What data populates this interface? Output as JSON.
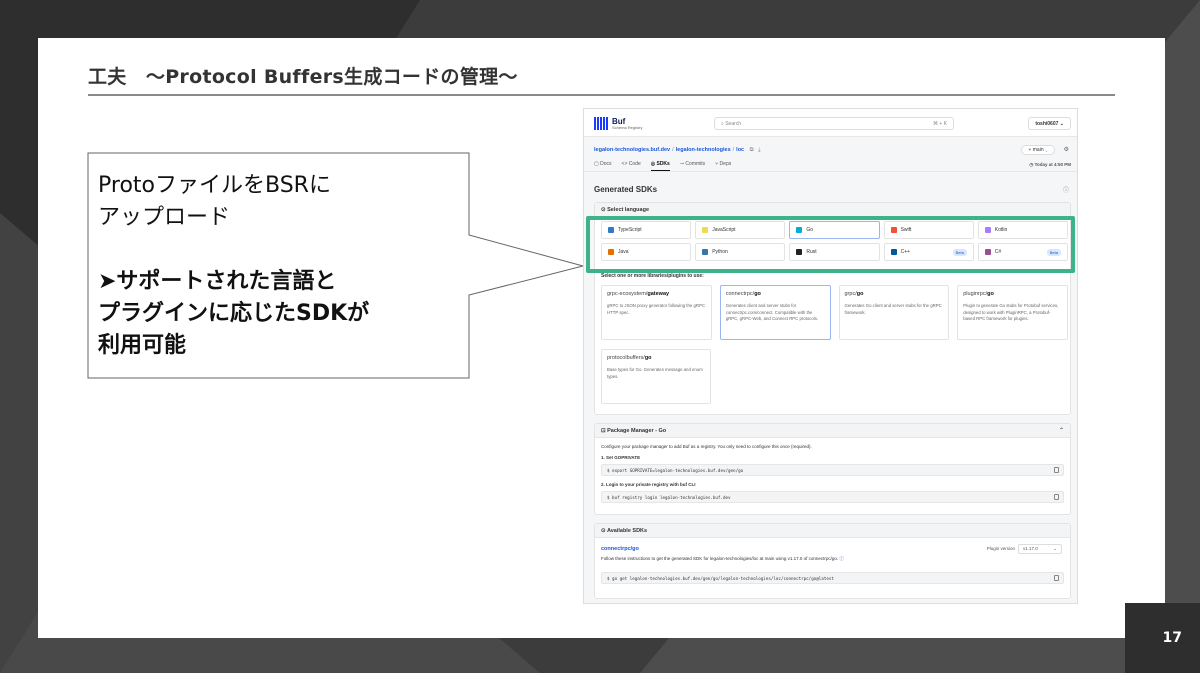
{
  "slide": {
    "title": "工夫　～Protocol Buffers生成コードの管理～",
    "page_number": "17"
  },
  "callout": {
    "line1": "ProtoファイルをBSRに",
    "line2": "アップロード",
    "line3": "➤サポートされた言語と",
    "line4": "プラグインに応じたSDKが",
    "line5": "利用可能"
  },
  "app": {
    "logo_title": "Buf",
    "logo_sub": "Schema Registry",
    "search_placeholder": "Search",
    "search_shortcut": "⌘ + K",
    "user": "toshi0607",
    "breadcrumb": [
      "legalon-technologies.buf.dev",
      "legalon-technologies",
      "loc"
    ],
    "branch": "main",
    "tabs": [
      "Docs",
      "Code",
      "SDKs",
      "Commits",
      "Deps"
    ],
    "updated": "Today at 4:50 PM",
    "section_title": "Generated SDKs",
    "select_language": "Select language",
    "languages": [
      {
        "name": "TypeScript",
        "color": "#3178c6"
      },
      {
        "name": "JavaScript",
        "color": "#f0db4f"
      },
      {
        "name": "Go",
        "color": "#00add8"
      },
      {
        "name": "Swift",
        "color": "#f05138"
      },
      {
        "name": "Kotlin",
        "color": "#a97bff"
      },
      {
        "name": "Java",
        "color": "#e76f00"
      },
      {
        "name": "Python",
        "color": "#3776ab"
      },
      {
        "name": "Rust",
        "color": "#222222"
      },
      {
        "name": "C++",
        "color": "#00599c",
        "badge": "Beta"
      },
      {
        "name": "C#",
        "color": "#9b4f96",
        "badge": "Beta"
      }
    ],
    "plugins_label": "Select one or more libraries/plugins to use:",
    "plugins": [
      {
        "prefix": "grpc-ecosystem/",
        "name": "gateway",
        "desc": "gRPC to JSON proxy generator following the gRPC HTTP spec."
      },
      {
        "prefix": "connectrpc/",
        "name": "go",
        "desc": "Generates client and server stubs for connectrpc.com/connect. Compatible with the gRPC, gRPC-Web, and Connect RPC protocols."
      },
      {
        "prefix": "grpc/",
        "name": "go",
        "desc": "Generates Go client and server stubs for the gRPC framework."
      },
      {
        "prefix": "pluginrpc/",
        "name": "go",
        "desc": "Plugin to generate Go stubs for Protobuf services, designed to work with PluginRPC, a Protobuf-based RPC framework for plugins."
      }
    ],
    "plugin_extra": {
      "prefix": "protocolbuffers/",
      "name": "go",
      "desc": "Base types for Go. Generates message and enum types."
    },
    "package_manager": {
      "title": "Package Manager - Go",
      "intro": "Configure your package manager to add Buf as a registry. You only need to configure this once (required).",
      "step1": "1. Set GOPRIVATE",
      "cmd1": "$ export GOPRIVATE=legalon-technologies.buf.dev/gen/go",
      "step2": "2. Login to your private registry with buf CLI",
      "cmd2": "$ buf registry login legalon-technologies.buf.dev"
    },
    "available": {
      "title": "Available SDKs",
      "sdk": "connectrpc/go",
      "plugin_version_label": "Plugin version",
      "plugin_version": "v1.17.0",
      "instructions": "Follow these instructions to get the generated SDK for legalon-technologies/loc at main using v1.17.0 of connectrpc/go.",
      "cmd": "$ go get legalon-technologies.buf.dev/gen/go/legalon-technologies/loc/connectrpc/go@latest"
    }
  }
}
